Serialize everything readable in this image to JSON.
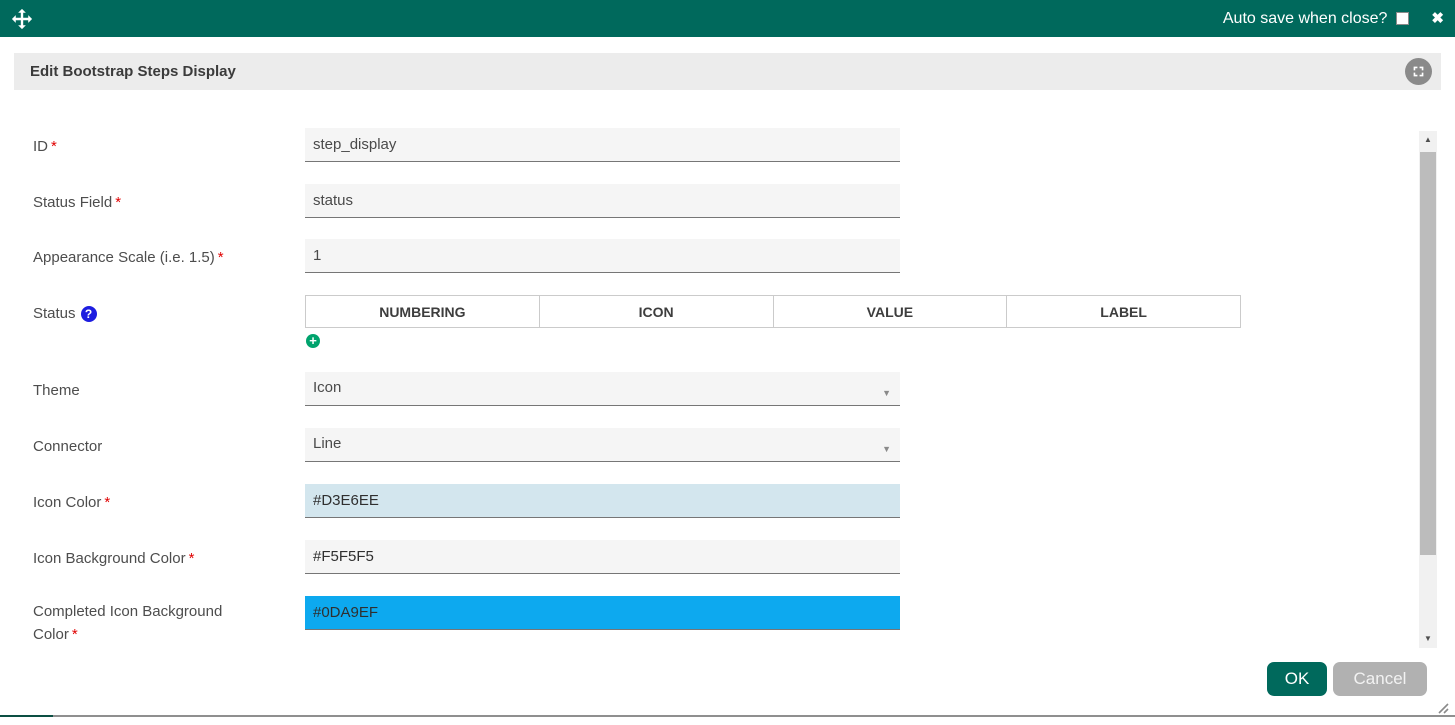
{
  "colors": {
    "accent_teal": "#00695C",
    "add_button_green": "#00A36D",
    "help_icon_blue": "#1D1DE0",
    "cancel_gray": "#B1B1B1",
    "icon_color_swatch": "#D3E6EE",
    "icon_background_swatch": "#F5F5F5",
    "completed_icon_background_swatch": "#0DA9EF"
  },
  "icons": {
    "move": "move-icon",
    "close_glyph": "✖",
    "expand": "expand-icon",
    "help_glyph": "?",
    "add_glyph": "+",
    "dropdown_glyph": "▼",
    "scroll_up_glyph": "▲",
    "scroll_down_glyph": "▼"
  },
  "titlebar": {
    "autosave_label": "Auto save when close?",
    "autosave_checked": false
  },
  "header": {
    "title": "Edit Bootstrap Steps Display"
  },
  "form": {
    "required_marker": "*",
    "fields": {
      "id": {
        "label": "ID",
        "required": true,
        "value": "step_display"
      },
      "status_field": {
        "label": "Status Field",
        "required": true,
        "value": "status"
      },
      "appearance_scale": {
        "label": "Appearance Scale (i.e. 1.5)",
        "required": true,
        "value": "1"
      },
      "status": {
        "label": "Status",
        "table_headers": [
          "NUMBERING",
          "ICON",
          "VALUE",
          "LABEL"
        ]
      },
      "theme": {
        "label": "Theme",
        "value": "Icon"
      },
      "connector": {
        "label": "Connector",
        "value": "Line"
      },
      "icon_color": {
        "label": "Icon Color",
        "required": true,
        "value": "#D3E6EE",
        "bg": "#D3E6EE"
      },
      "icon_background_color": {
        "label": "Icon Background Color",
        "required": true,
        "value": "#F5F5F5",
        "bg": "#F5F5F5"
      },
      "completed_icon_background_color": {
        "label": "Completed Icon Background Color",
        "required": true,
        "value": "#0DA9EF",
        "bg": "#0DA9EF"
      }
    }
  },
  "footer": {
    "ok_label": "OK",
    "cancel_label": "Cancel"
  }
}
